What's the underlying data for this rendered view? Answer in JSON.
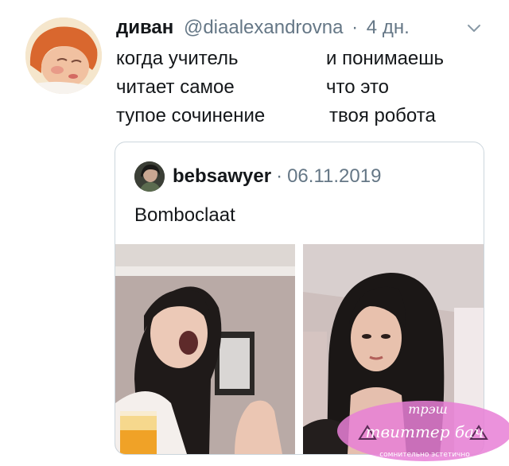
{
  "tweet": {
    "display_name": "диван",
    "handle": "@diaalexandrovna",
    "separator": "·",
    "time": "4 дн.",
    "text_rows": [
      {
        "left": "когда учитель",
        "right": "и понимаешь"
      },
      {
        "left": "читает самое",
        "right": "что это"
      },
      {
        "left": "тупое сочинение",
        "right": "твоя робота"
      }
    ]
  },
  "quoted_tweet": {
    "username": "bebsawyer",
    "separator": "·",
    "date": "06.11.2019",
    "text": "Bomboclaat"
  },
  "watermark": {
    "line1": "трэш",
    "line2": "твиттер бач",
    "line3": "сомнительно эстетично"
  },
  "colors": {
    "text": "#14171a",
    "secondary": "#657786",
    "border": "#ccd6dd",
    "watermark_pink": "#e77fd6"
  },
  "icons": {
    "chevron": "chevron-down-icon"
  }
}
